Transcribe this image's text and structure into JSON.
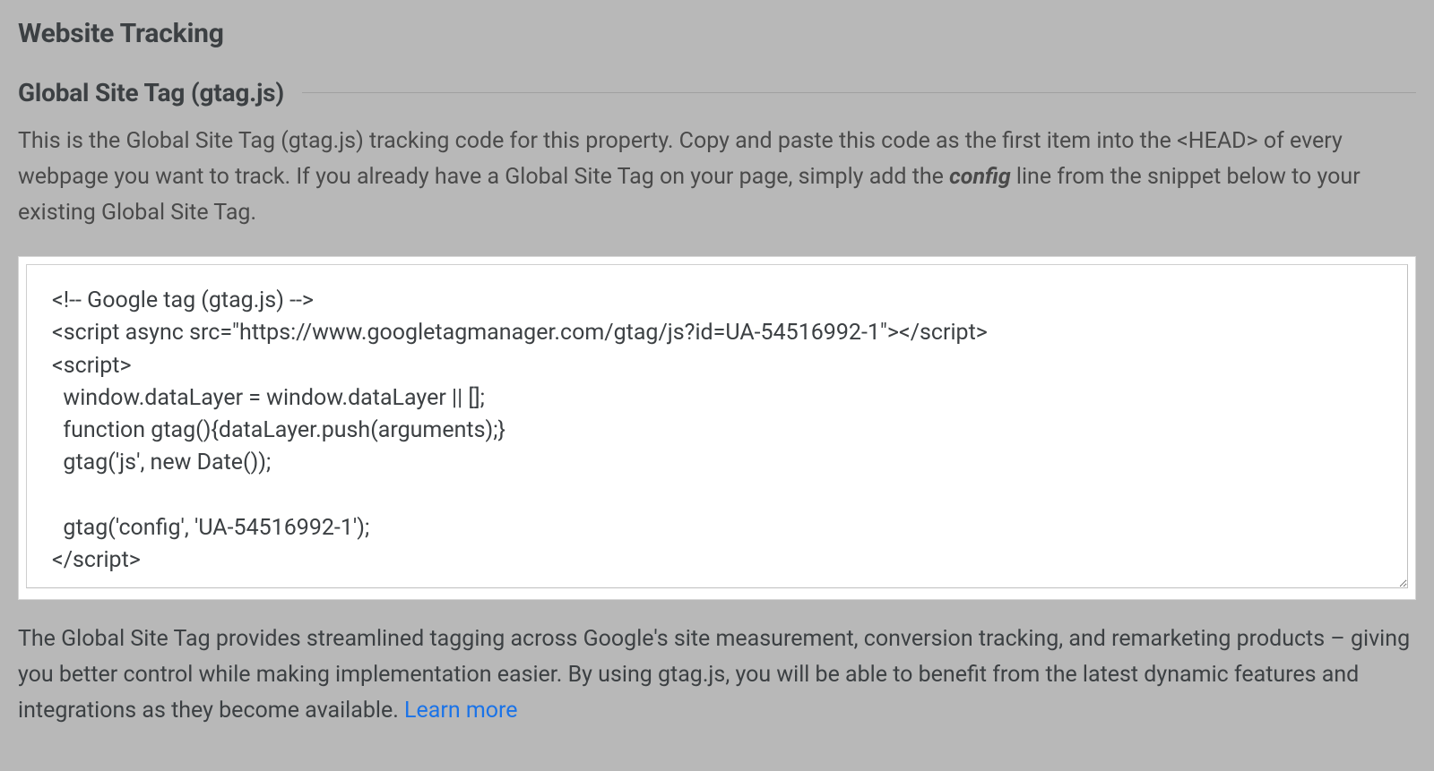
{
  "section": {
    "title": "Website Tracking"
  },
  "subsection": {
    "title": "Global Site Tag (gtag.js)"
  },
  "description": {
    "pre": "This is the Global Site Tag (gtag.js) tracking code for this property. Copy and paste this code as the first item into the <HEAD> of every webpage you want to track. If you already have a Global Site Tag on your page, simply add the ",
    "emphasis": "config",
    "post": " line from the snippet below to your existing Global Site Tag."
  },
  "code": "<!-- Google tag (gtag.js) -->\n<script async src=\"https://www.googletagmanager.com/gtag/js?id=UA-54516992-1\"></script>\n<script>\n  window.dataLayer = window.dataLayer || [];\n  function gtag(){dataLayer.push(arguments);}\n  gtag('js', new Date());\n\n  gtag('config', 'UA-54516992-1');\n</script>",
  "footer": {
    "text": "The Global Site Tag provides streamlined tagging across Google's site measurement, conversion tracking, and remarketing products – giving you better control while making implementation easier. By using gtag.js, you will be able to benefit from the latest dynamic features and integrations as they become available. ",
    "link": "Learn more"
  }
}
